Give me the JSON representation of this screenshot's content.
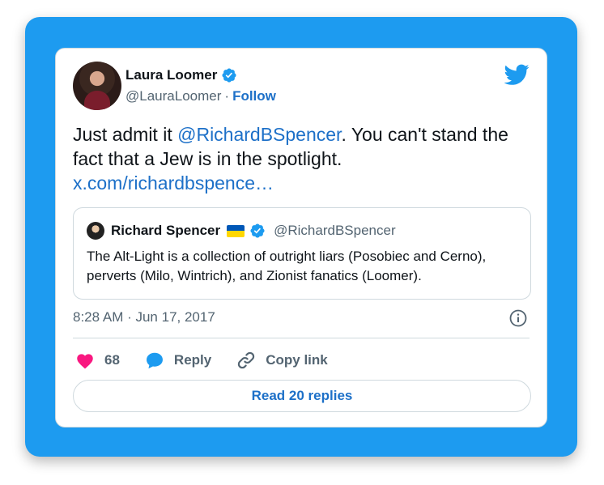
{
  "author": {
    "name": "Laura Loomer",
    "handle": "@LauraLoomer",
    "separator": "·",
    "follow_label": "Follow",
    "verified": true
  },
  "tweet": {
    "text_before": "Just admit it ",
    "mention": "@RichardBSpencer",
    "text_after": ". You can't stand the fact that a Jew is in the spotlight.",
    "link": "x.com/richardbspence…"
  },
  "quoted": {
    "name": "Richard Spencer",
    "handle": "@RichardBSpencer",
    "flag": "ukraine-flag",
    "verified": true,
    "text": "The Alt-Light is a collection of outright liars (Posobiec and Cerno), perverts (Milo, Wintrich), and Zionist fanatics (Loomer)."
  },
  "meta": {
    "timestamp": "8:28 AM · Jun 17, 2017"
  },
  "actions": {
    "like_count": "68",
    "reply_label": "Reply",
    "copy_label": "Copy link"
  },
  "read_replies_label": "Read 20 replies",
  "colors": {
    "frame": "#1d9bf0",
    "link": "#1d70c8",
    "like": "#f91880",
    "verified": "#1d9bf0",
    "flag_blue": "#0057b7",
    "flag_yellow": "#ffd700"
  }
}
